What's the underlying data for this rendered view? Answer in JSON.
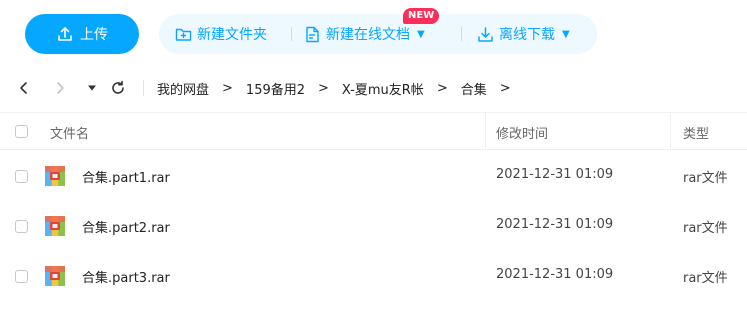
{
  "toolbar": {
    "upload_label": "上传",
    "new_folder_label": "新建文件夹",
    "new_online_doc_label": "新建在线文档",
    "new_badge": "NEW",
    "offline_download_label": "离线下载",
    "caret": "▼",
    "accent_color": "#06a7ff"
  },
  "breadcrumb": {
    "items": [
      "我的网盘",
      "159备用2",
      "X-夏mu友R帐",
      "合集"
    ],
    "separator": ">"
  },
  "table": {
    "headers": {
      "name": "文件名",
      "modified": "修改时间",
      "type": "类型"
    },
    "rows": [
      {
        "name": "合集.part1.rar",
        "modified": "2021-12-31 01:09",
        "type": "rar文件",
        "icon": "rar-archive-icon"
      },
      {
        "name": "合集.part2.rar",
        "modified": "2021-12-31 01:09",
        "type": "rar文件",
        "icon": "rar-archive-icon"
      },
      {
        "name": "合集.part3.rar",
        "modified": "2021-12-31 01:09",
        "type": "rar文件",
        "icon": "rar-archive-icon"
      }
    ]
  }
}
